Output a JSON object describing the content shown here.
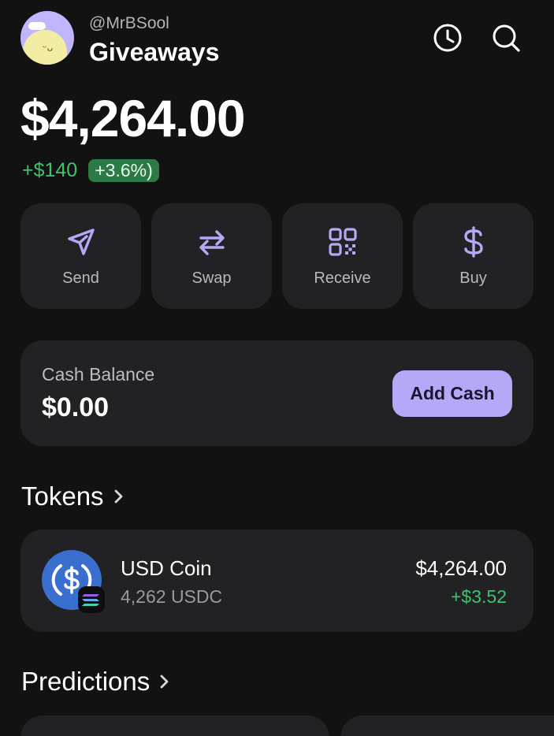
{
  "profile": {
    "handle": "@MrBSool",
    "subtitle": "Giveaways",
    "face": "ᵕᴗ"
  },
  "header_icons": [
    "history-icon",
    "search-icon"
  ],
  "portfolio": {
    "balance": "$4,264.00",
    "change_amount": "+$140",
    "change_percent": "+3.6%)"
  },
  "actions": [
    {
      "label": "Send",
      "icon": "send-icon"
    },
    {
      "label": "Swap",
      "icon": "swap-icon"
    },
    {
      "label": "Receive",
      "icon": "qr-code-icon"
    },
    {
      "label": "Buy",
      "icon": "dollar-icon"
    }
  ],
  "cash": {
    "label": "Cash Balance",
    "value": "$0.00",
    "button": "Add Cash"
  },
  "tokens": {
    "title": "Tokens",
    "items": [
      {
        "name": "USD Coin",
        "amount": "4,262 USDC",
        "value": "$4,264.00",
        "change": "+$3.52",
        "icon": "usdc-icon",
        "chain_badge": "solana-badge-icon"
      }
    ]
  },
  "predictions": {
    "title": "Predictions"
  },
  "colors": {
    "background": "#121212",
    "card": "#222224",
    "accent": "#b5a8f6",
    "positive": "#3ec26d",
    "usdc": "#3a6fd0"
  }
}
